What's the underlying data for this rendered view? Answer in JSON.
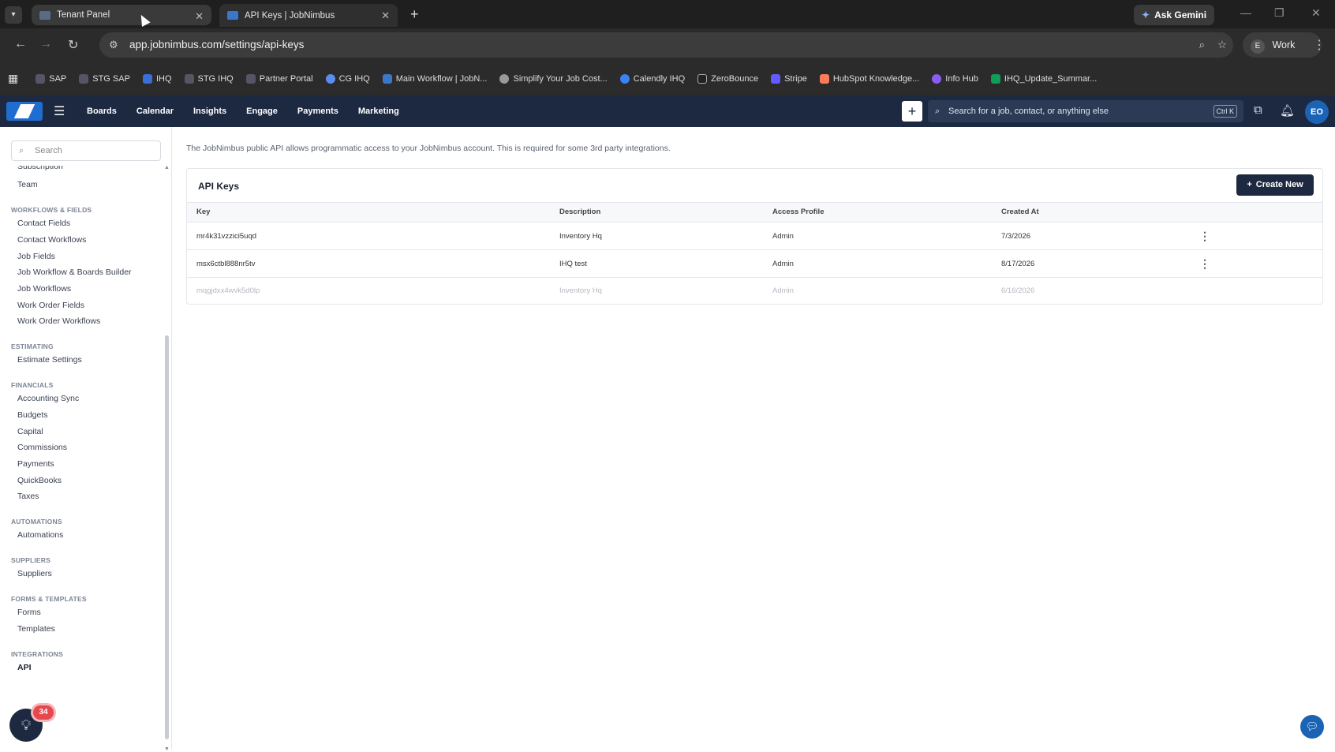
{
  "browser": {
    "tabs": [
      {
        "title": "Tenant Panel",
        "active": false
      },
      {
        "title": "API Keys | JobNimbus",
        "active": true
      }
    ],
    "gemini_label": "Ask Gemini",
    "url": "app.jobnimbus.com/settings/api-keys",
    "profile_initial": "E",
    "profile_label": "Work",
    "bookmarks": [
      "SAP",
      "STG SAP",
      "IHQ",
      "STG IHQ",
      "Partner Portal",
      "CG IHQ",
      "Main Workflow | JobN...",
      "Simplify Your Job Cost...",
      "Calendly IHQ",
      "ZeroBounce",
      "Stripe",
      "HubSpot Knowledge...",
      "Info Hub",
      "IHQ_Update_Summar..."
    ]
  },
  "app": {
    "nav": [
      "Boards",
      "Calendar",
      "Insights",
      "Engage",
      "Payments",
      "Marketing"
    ],
    "search_placeholder": "Search for a job, contact, or anything else",
    "search_shortcut": "Ctrl K",
    "avatar": "EO",
    "accent_color": "#1c2940"
  },
  "sidebar": {
    "search_placeholder": "Search",
    "partial_item": "Subscription",
    "top_items": [
      "Team"
    ],
    "sections": [
      {
        "title": "WORKFLOWS & FIELDS",
        "items": [
          "Contact Fields",
          "Contact Workflows",
          "Job Fields",
          "Job Workflow & Boards Builder",
          "Job Workflows",
          "Work Order Fields",
          "Work Order Workflows"
        ]
      },
      {
        "title": "ESTIMATING",
        "items": [
          "Estimate Settings"
        ]
      },
      {
        "title": "FINANCIALS",
        "items": [
          "Accounting Sync",
          "Budgets",
          "Capital",
          "Commissions",
          "Payments",
          "QuickBooks",
          "Taxes"
        ]
      },
      {
        "title": "AUTOMATIONS",
        "items": [
          "Automations"
        ]
      },
      {
        "title": "SUPPLIERS",
        "items": [
          "Suppliers"
        ]
      },
      {
        "title": "FORMS & TEMPLATES",
        "items": [
          "Forms",
          "Templates"
        ]
      },
      {
        "title": "INTEGRATIONS",
        "items": [
          "API"
        ]
      }
    ],
    "active_item": "API",
    "hint_badge": "34"
  },
  "main": {
    "intro": "The JobNimbus public API allows programmatic access to your JobNimbus account. This is required for some 3rd party integrations.",
    "card_title": "API Keys",
    "create_label": "Create New",
    "columns": [
      "Key",
      "Description",
      "Access Profile",
      "Created At"
    ],
    "rows": [
      {
        "key": "mr4k31vzzici5uqd",
        "description": "Inventory Hq",
        "profile": "Admin",
        "created": "7/3/2026",
        "dim": false
      },
      {
        "key": "msx6ctbl888nr5tv",
        "description": "IHQ test",
        "profile": "Admin",
        "created": "8/17/2026",
        "dim": false
      },
      {
        "key": "mqgjdxx4wvk5d0lp",
        "description": "Inventory Hq",
        "profile": "Admin",
        "created": "6/16/2026",
        "dim": true
      }
    ]
  }
}
